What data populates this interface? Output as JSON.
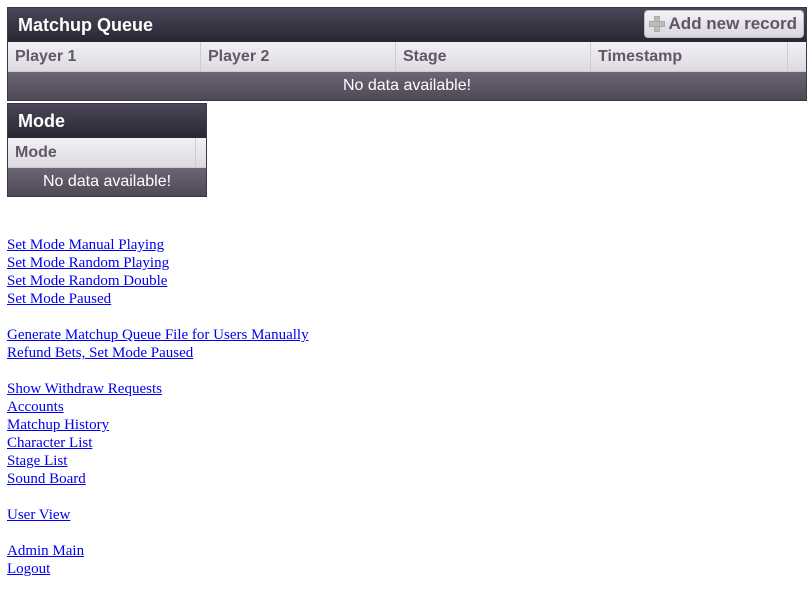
{
  "matchup_queue": {
    "title": "Matchup Queue",
    "add_label": "Add new record",
    "columns": [
      "Player 1",
      "Player 2",
      "Stage",
      "Timestamp"
    ],
    "no_data": "No data available!"
  },
  "mode": {
    "title": "Mode",
    "columns": [
      "Mode"
    ],
    "no_data": "No data available!"
  },
  "links": {
    "group1": [
      "Set Mode Manual Playing",
      "Set Mode Random Playing",
      "Set Mode Random Double",
      "Set Mode Paused"
    ],
    "group2": [
      "Generate Matchup Queue File for Users Manually",
      "Refund Bets, Set Mode Paused"
    ],
    "group3": [
      "Show Withdraw Requests",
      "Accounts",
      "Matchup History",
      "Character List",
      "Stage List",
      "Sound Board"
    ],
    "group4": [
      "User View"
    ],
    "group5": [
      "Admin Main",
      "Logout"
    ]
  }
}
